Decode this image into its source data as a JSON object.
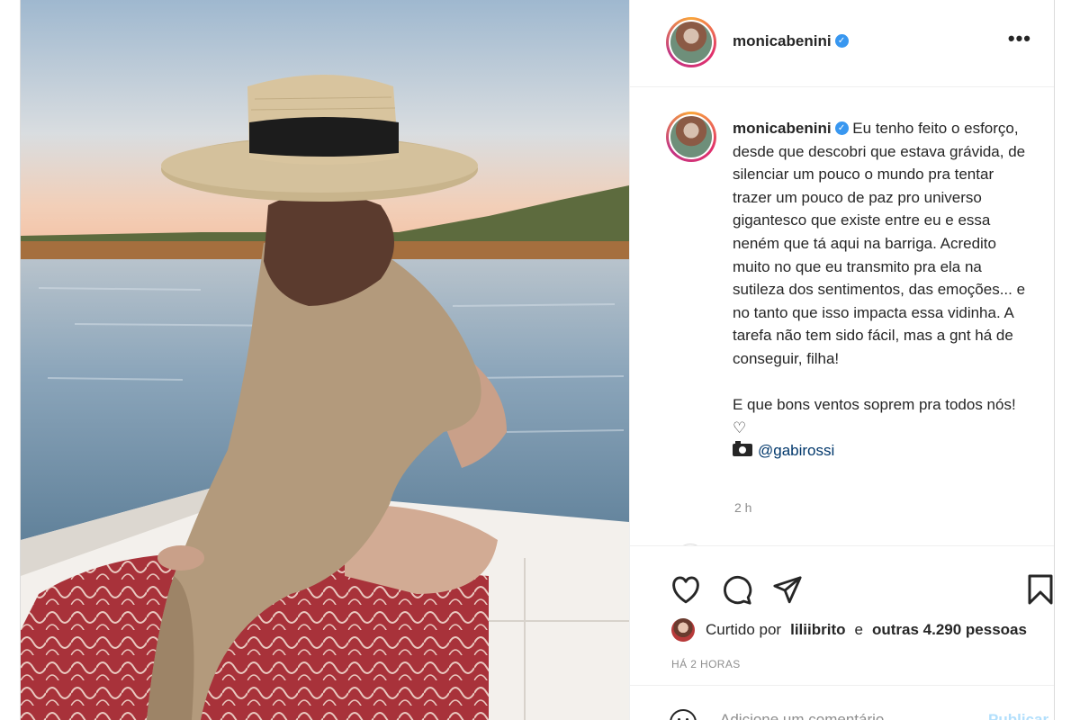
{
  "post": {
    "username": "monicabenini",
    "verified_icon": "verified-badge-icon",
    "more_icon": "more-options-icon",
    "more_label": "•••"
  },
  "caption": {
    "username": "monicabenini",
    "text": " Eu tenho feito o esforço, desde que descobri que estava grávida, de silenciar um pouco o mundo pra tentar trazer um pouco de paz pro universo gigantesco que existe entre eu e essa neném que tá aqui na barriga. Acredito muito no que eu transmito pra ela na sutileza dos sentimentos, das emoções... e no tanto que isso impacta essa vidinha. A tarefa não tem sido fácil, mas a gnt há de conseguir, filha!\n\nE que bons ventos soprem pra todos nós! ♡\n",
    "camera_icon": "camera-icon",
    "mention": "@gabirossi",
    "time_short": "2 h"
  },
  "actions": {
    "like_icon": "heart-icon",
    "comment_icon": "comment-bubble-icon",
    "share_icon": "paper-plane-icon",
    "save_icon": "bookmark-icon"
  },
  "likes": {
    "prefix": "Curtido por",
    "user": "liliibrito",
    "connector": "e",
    "others": "outras 4.290 pessoas"
  },
  "timestamp": "HÁ 2 HORAS",
  "comment": {
    "emoji_icon": "emoji-smiley-icon",
    "placeholder": "Adicione um comentário...",
    "post_label": "Publicar"
  },
  "colors": {
    "link": "#00376b",
    "verified": "#3897f0",
    "post_button_disabled": "#b2dffc",
    "muted_text": "#8e8e8e",
    "border": "#dbdbdb"
  }
}
